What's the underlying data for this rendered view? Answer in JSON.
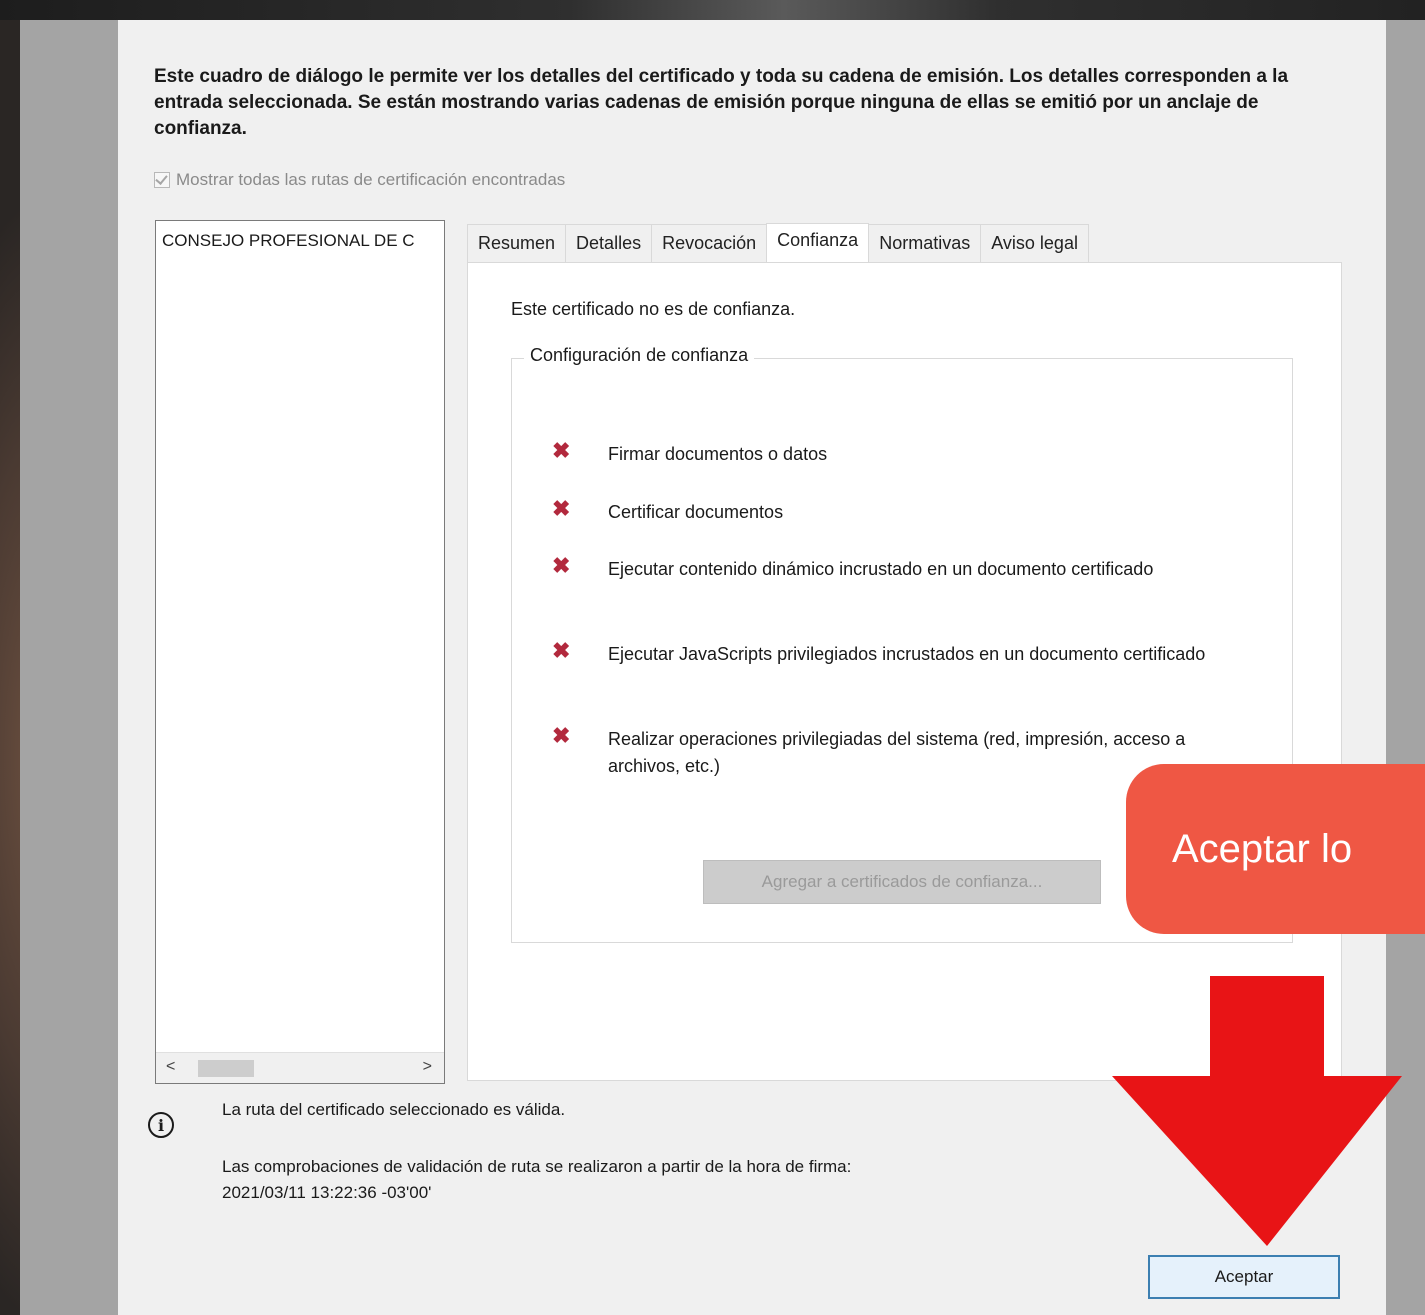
{
  "dialog": {
    "intro": "Este cuadro de diálogo le permite ver los detalles del certificado y toda su cadena de emisión. Los detalles corresponden a la entrada seleccionada. Se están mostrando varias cadenas de emisión porque ninguna de ellas se emitió por un anclaje de confianza.",
    "show_all_label": "Mostrar todas las rutas de certificación encontradas",
    "chain_items": [
      "CONSEJO PROFESIONAL DE C"
    ],
    "tabs": [
      {
        "label": "Resumen"
      },
      {
        "label": "Detalles"
      },
      {
        "label": "Revocación"
      },
      {
        "label": "Confianza",
        "active": true
      },
      {
        "label": "Normativas"
      },
      {
        "label": "Aviso legal"
      }
    ],
    "trust_panel": {
      "status": "Este certificado no es de confianza.",
      "group_title": "Configuración de confianza",
      "permissions": [
        "Firmar documentos o datos",
        "Certificar documentos",
        "Ejecutar contenido dinámico incrustado en un documento certificado",
        "Ejecutar JavaScripts privilegiados incrustados en un documento certificado",
        "Realizar operaciones privilegiadas del sistema (red, impresión, acceso a archivos, etc.)"
      ],
      "add_button": "Agregar a certificados de confianza..."
    },
    "validity_text": "La ruta del certificado seleccionado es válida.",
    "validation_check_line1": "Las comprobaciones de validación de ruta se realizaron a partir de la hora de firma:",
    "validation_check_line2": "2021/03/11 13:22:36 -03'00'",
    "ok_button": "Aceptar"
  },
  "overlay": {
    "callout_text": "Aceptar lo",
    "callout_color": "#ef5744",
    "arrow_color": "#e81416"
  },
  "colors": {
    "deny_icon": "#b2293d",
    "selected_button_border": "#3c7fb1"
  }
}
